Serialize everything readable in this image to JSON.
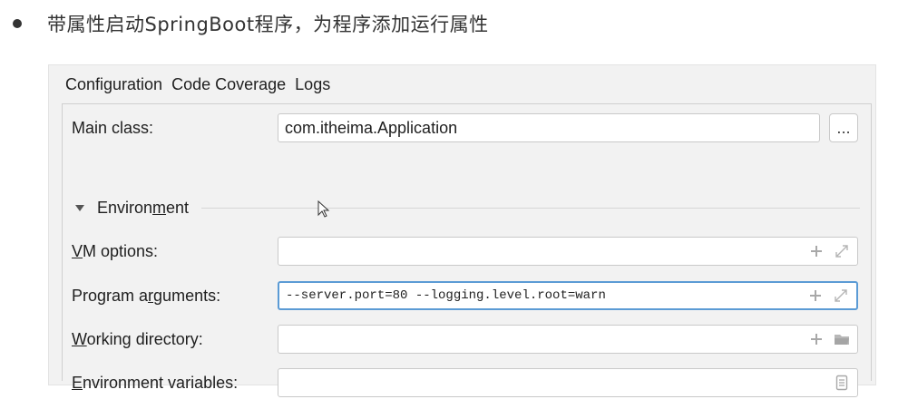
{
  "slide": {
    "bullet_text": "带属性启动SpringBoot程序，为程序添加运行属性"
  },
  "tabs": [
    {
      "label": "Configuration",
      "active": true
    },
    {
      "label": "Code Coverage",
      "active": false
    },
    {
      "label": "Logs",
      "active": false
    }
  ],
  "main_class": {
    "label": "Main class:",
    "value": "com.itheima.Application",
    "browse_label": "..."
  },
  "environment": {
    "title_pre": "Environ",
    "title_underlined": "m",
    "title_post": "ent"
  },
  "vm_options": {
    "label_underlined": "V",
    "label_rest": "M options:",
    "value": ""
  },
  "program_arguments": {
    "label_pre": "Program a",
    "label_underlined": "r",
    "label_post": "guments:",
    "value": "--server.port=80 --logging.level.root=warn"
  },
  "working_directory": {
    "label_underlined": "W",
    "label_rest": "orking directory:",
    "value": ""
  },
  "environment_variables": {
    "label_underlined": "E",
    "label_rest": "nvironment variables:",
    "value": ""
  },
  "colors": {
    "accent": "#3b82c4",
    "focus_border": "#5b9bd5",
    "panel_bg": "#f2f2f2"
  }
}
